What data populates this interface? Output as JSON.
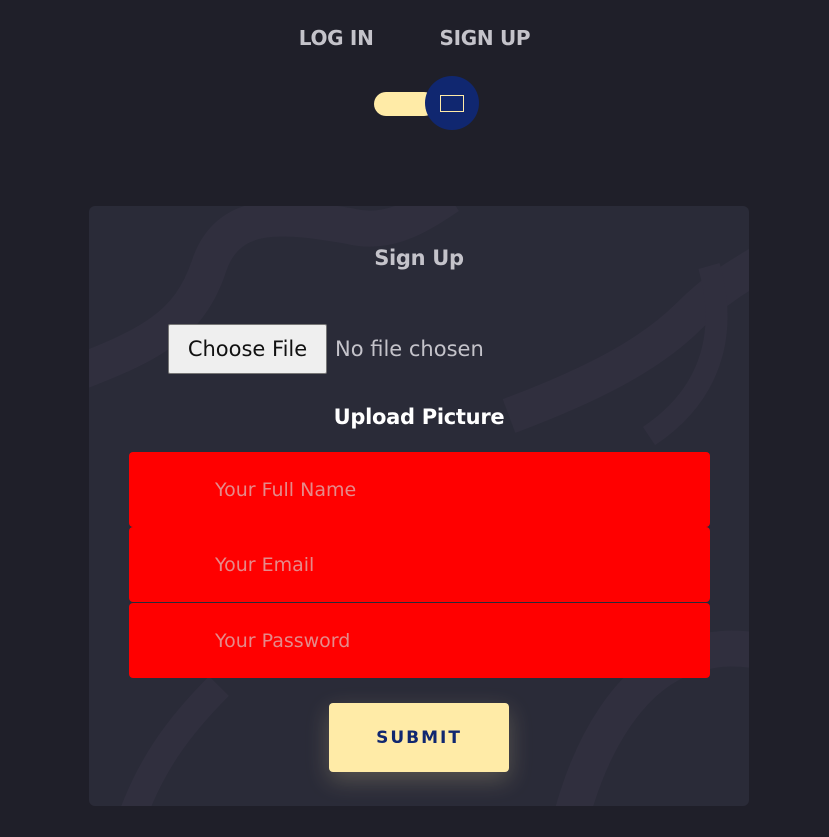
{
  "tabs": {
    "login": "LOG IN",
    "signup": "SIGN UP"
  },
  "card": {
    "title": "Sign Up",
    "file": {
      "button": "Choose File",
      "status": "No file chosen"
    },
    "upload_label": "Upload Picture",
    "fields": {
      "name_placeholder": "Your Full Name",
      "email_placeholder": "Your Email",
      "password_placeholder": "Your Password"
    },
    "submit": "SUBMIT"
  },
  "colors": {
    "background": "#1f1f29",
    "card": "#2a2b38",
    "accent": "#ffeba7",
    "knob": "#102770",
    "field": "#ff0000"
  }
}
